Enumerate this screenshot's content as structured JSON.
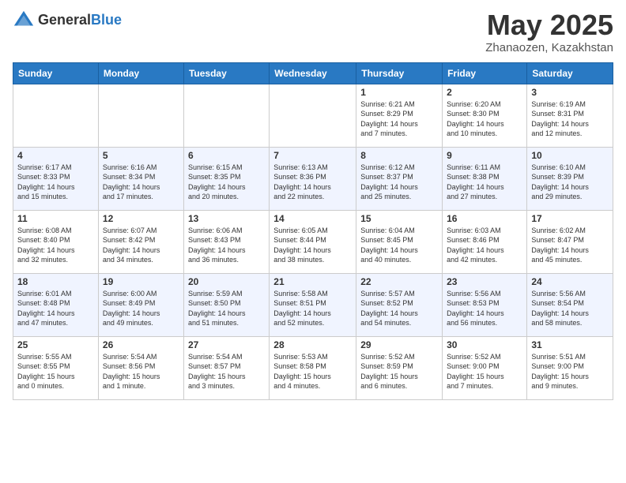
{
  "header": {
    "logo_general": "General",
    "logo_blue": "Blue",
    "title": "May 2025",
    "location": "Zhanaozen, Kazakhstan"
  },
  "days_of_week": [
    "Sunday",
    "Monday",
    "Tuesday",
    "Wednesday",
    "Thursday",
    "Friday",
    "Saturday"
  ],
  "weeks": [
    [
      {
        "day": "",
        "info": ""
      },
      {
        "day": "",
        "info": ""
      },
      {
        "day": "",
        "info": ""
      },
      {
        "day": "",
        "info": ""
      },
      {
        "day": "1",
        "info": "Sunrise: 6:21 AM\nSunset: 8:29 PM\nDaylight: 14 hours\nand 7 minutes."
      },
      {
        "day": "2",
        "info": "Sunrise: 6:20 AM\nSunset: 8:30 PM\nDaylight: 14 hours\nand 10 minutes."
      },
      {
        "day": "3",
        "info": "Sunrise: 6:19 AM\nSunset: 8:31 PM\nDaylight: 14 hours\nand 12 minutes."
      }
    ],
    [
      {
        "day": "4",
        "info": "Sunrise: 6:17 AM\nSunset: 8:33 PM\nDaylight: 14 hours\nand 15 minutes."
      },
      {
        "day": "5",
        "info": "Sunrise: 6:16 AM\nSunset: 8:34 PM\nDaylight: 14 hours\nand 17 minutes."
      },
      {
        "day": "6",
        "info": "Sunrise: 6:15 AM\nSunset: 8:35 PM\nDaylight: 14 hours\nand 20 minutes."
      },
      {
        "day": "7",
        "info": "Sunrise: 6:13 AM\nSunset: 8:36 PM\nDaylight: 14 hours\nand 22 minutes."
      },
      {
        "day": "8",
        "info": "Sunrise: 6:12 AM\nSunset: 8:37 PM\nDaylight: 14 hours\nand 25 minutes."
      },
      {
        "day": "9",
        "info": "Sunrise: 6:11 AM\nSunset: 8:38 PM\nDaylight: 14 hours\nand 27 minutes."
      },
      {
        "day": "10",
        "info": "Sunrise: 6:10 AM\nSunset: 8:39 PM\nDaylight: 14 hours\nand 29 minutes."
      }
    ],
    [
      {
        "day": "11",
        "info": "Sunrise: 6:08 AM\nSunset: 8:40 PM\nDaylight: 14 hours\nand 32 minutes."
      },
      {
        "day": "12",
        "info": "Sunrise: 6:07 AM\nSunset: 8:42 PM\nDaylight: 14 hours\nand 34 minutes."
      },
      {
        "day": "13",
        "info": "Sunrise: 6:06 AM\nSunset: 8:43 PM\nDaylight: 14 hours\nand 36 minutes."
      },
      {
        "day": "14",
        "info": "Sunrise: 6:05 AM\nSunset: 8:44 PM\nDaylight: 14 hours\nand 38 minutes."
      },
      {
        "day": "15",
        "info": "Sunrise: 6:04 AM\nSunset: 8:45 PM\nDaylight: 14 hours\nand 40 minutes."
      },
      {
        "day": "16",
        "info": "Sunrise: 6:03 AM\nSunset: 8:46 PM\nDaylight: 14 hours\nand 42 minutes."
      },
      {
        "day": "17",
        "info": "Sunrise: 6:02 AM\nSunset: 8:47 PM\nDaylight: 14 hours\nand 45 minutes."
      }
    ],
    [
      {
        "day": "18",
        "info": "Sunrise: 6:01 AM\nSunset: 8:48 PM\nDaylight: 14 hours\nand 47 minutes."
      },
      {
        "day": "19",
        "info": "Sunrise: 6:00 AM\nSunset: 8:49 PM\nDaylight: 14 hours\nand 49 minutes."
      },
      {
        "day": "20",
        "info": "Sunrise: 5:59 AM\nSunset: 8:50 PM\nDaylight: 14 hours\nand 51 minutes."
      },
      {
        "day": "21",
        "info": "Sunrise: 5:58 AM\nSunset: 8:51 PM\nDaylight: 14 hours\nand 52 minutes."
      },
      {
        "day": "22",
        "info": "Sunrise: 5:57 AM\nSunset: 8:52 PM\nDaylight: 14 hours\nand 54 minutes."
      },
      {
        "day": "23",
        "info": "Sunrise: 5:56 AM\nSunset: 8:53 PM\nDaylight: 14 hours\nand 56 minutes."
      },
      {
        "day": "24",
        "info": "Sunrise: 5:56 AM\nSunset: 8:54 PM\nDaylight: 14 hours\nand 58 minutes."
      }
    ],
    [
      {
        "day": "25",
        "info": "Sunrise: 5:55 AM\nSunset: 8:55 PM\nDaylight: 15 hours\nand 0 minutes."
      },
      {
        "day": "26",
        "info": "Sunrise: 5:54 AM\nSunset: 8:56 PM\nDaylight: 15 hours\nand 1 minute."
      },
      {
        "day": "27",
        "info": "Sunrise: 5:54 AM\nSunset: 8:57 PM\nDaylight: 15 hours\nand 3 minutes."
      },
      {
        "day": "28",
        "info": "Sunrise: 5:53 AM\nSunset: 8:58 PM\nDaylight: 15 hours\nand 4 minutes."
      },
      {
        "day": "29",
        "info": "Sunrise: 5:52 AM\nSunset: 8:59 PM\nDaylight: 15 hours\nand 6 minutes."
      },
      {
        "day": "30",
        "info": "Sunrise: 5:52 AM\nSunset: 9:00 PM\nDaylight: 15 hours\nand 7 minutes."
      },
      {
        "day": "31",
        "info": "Sunrise: 5:51 AM\nSunset: 9:00 PM\nDaylight: 15 hours\nand 9 minutes."
      }
    ]
  ]
}
